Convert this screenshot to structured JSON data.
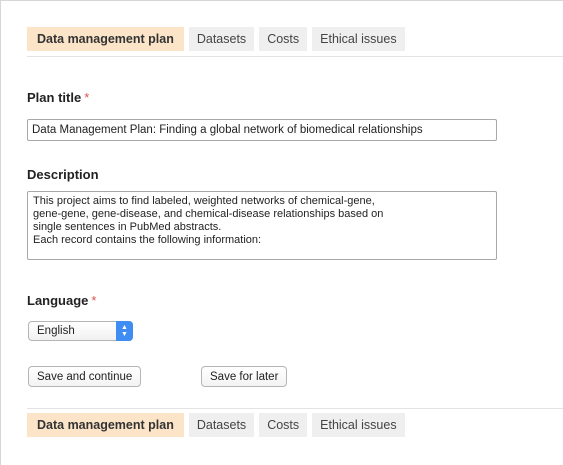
{
  "tabs_top": [
    {
      "label": "Data management plan",
      "active": true
    },
    {
      "label": "Datasets",
      "active": false
    },
    {
      "label": "Costs",
      "active": false
    },
    {
      "label": "Ethical issues",
      "active": false
    }
  ],
  "form": {
    "plan_title": {
      "label": "Plan title",
      "required_mark": "*",
      "value": "Data Management Plan: Finding a global network of biomedical relationships"
    },
    "description": {
      "label": "Description",
      "value": "This project aims to find labeled, weighted networks of chemical-gene,\ngene-gene, gene-disease, and chemical-disease relationships based on\nsingle sentences in PubMed abstracts.\nEach record contains the following information:"
    },
    "language": {
      "label": "Language",
      "required_mark": "*",
      "selected": "English"
    }
  },
  "buttons": {
    "save_continue": "Save and continue",
    "save_later": "Save for later"
  },
  "tabs_bottom": [
    {
      "label": "Data management plan",
      "active": true
    },
    {
      "label": "Datasets",
      "active": false
    },
    {
      "label": "Costs",
      "active": false
    },
    {
      "label": "Ethical issues",
      "active": false
    }
  ],
  "colors": {
    "active_tab": "#fbe4c8",
    "inactive_tab": "#efefef",
    "required": "#d9534f",
    "select_accent": "#3f8cf3"
  }
}
